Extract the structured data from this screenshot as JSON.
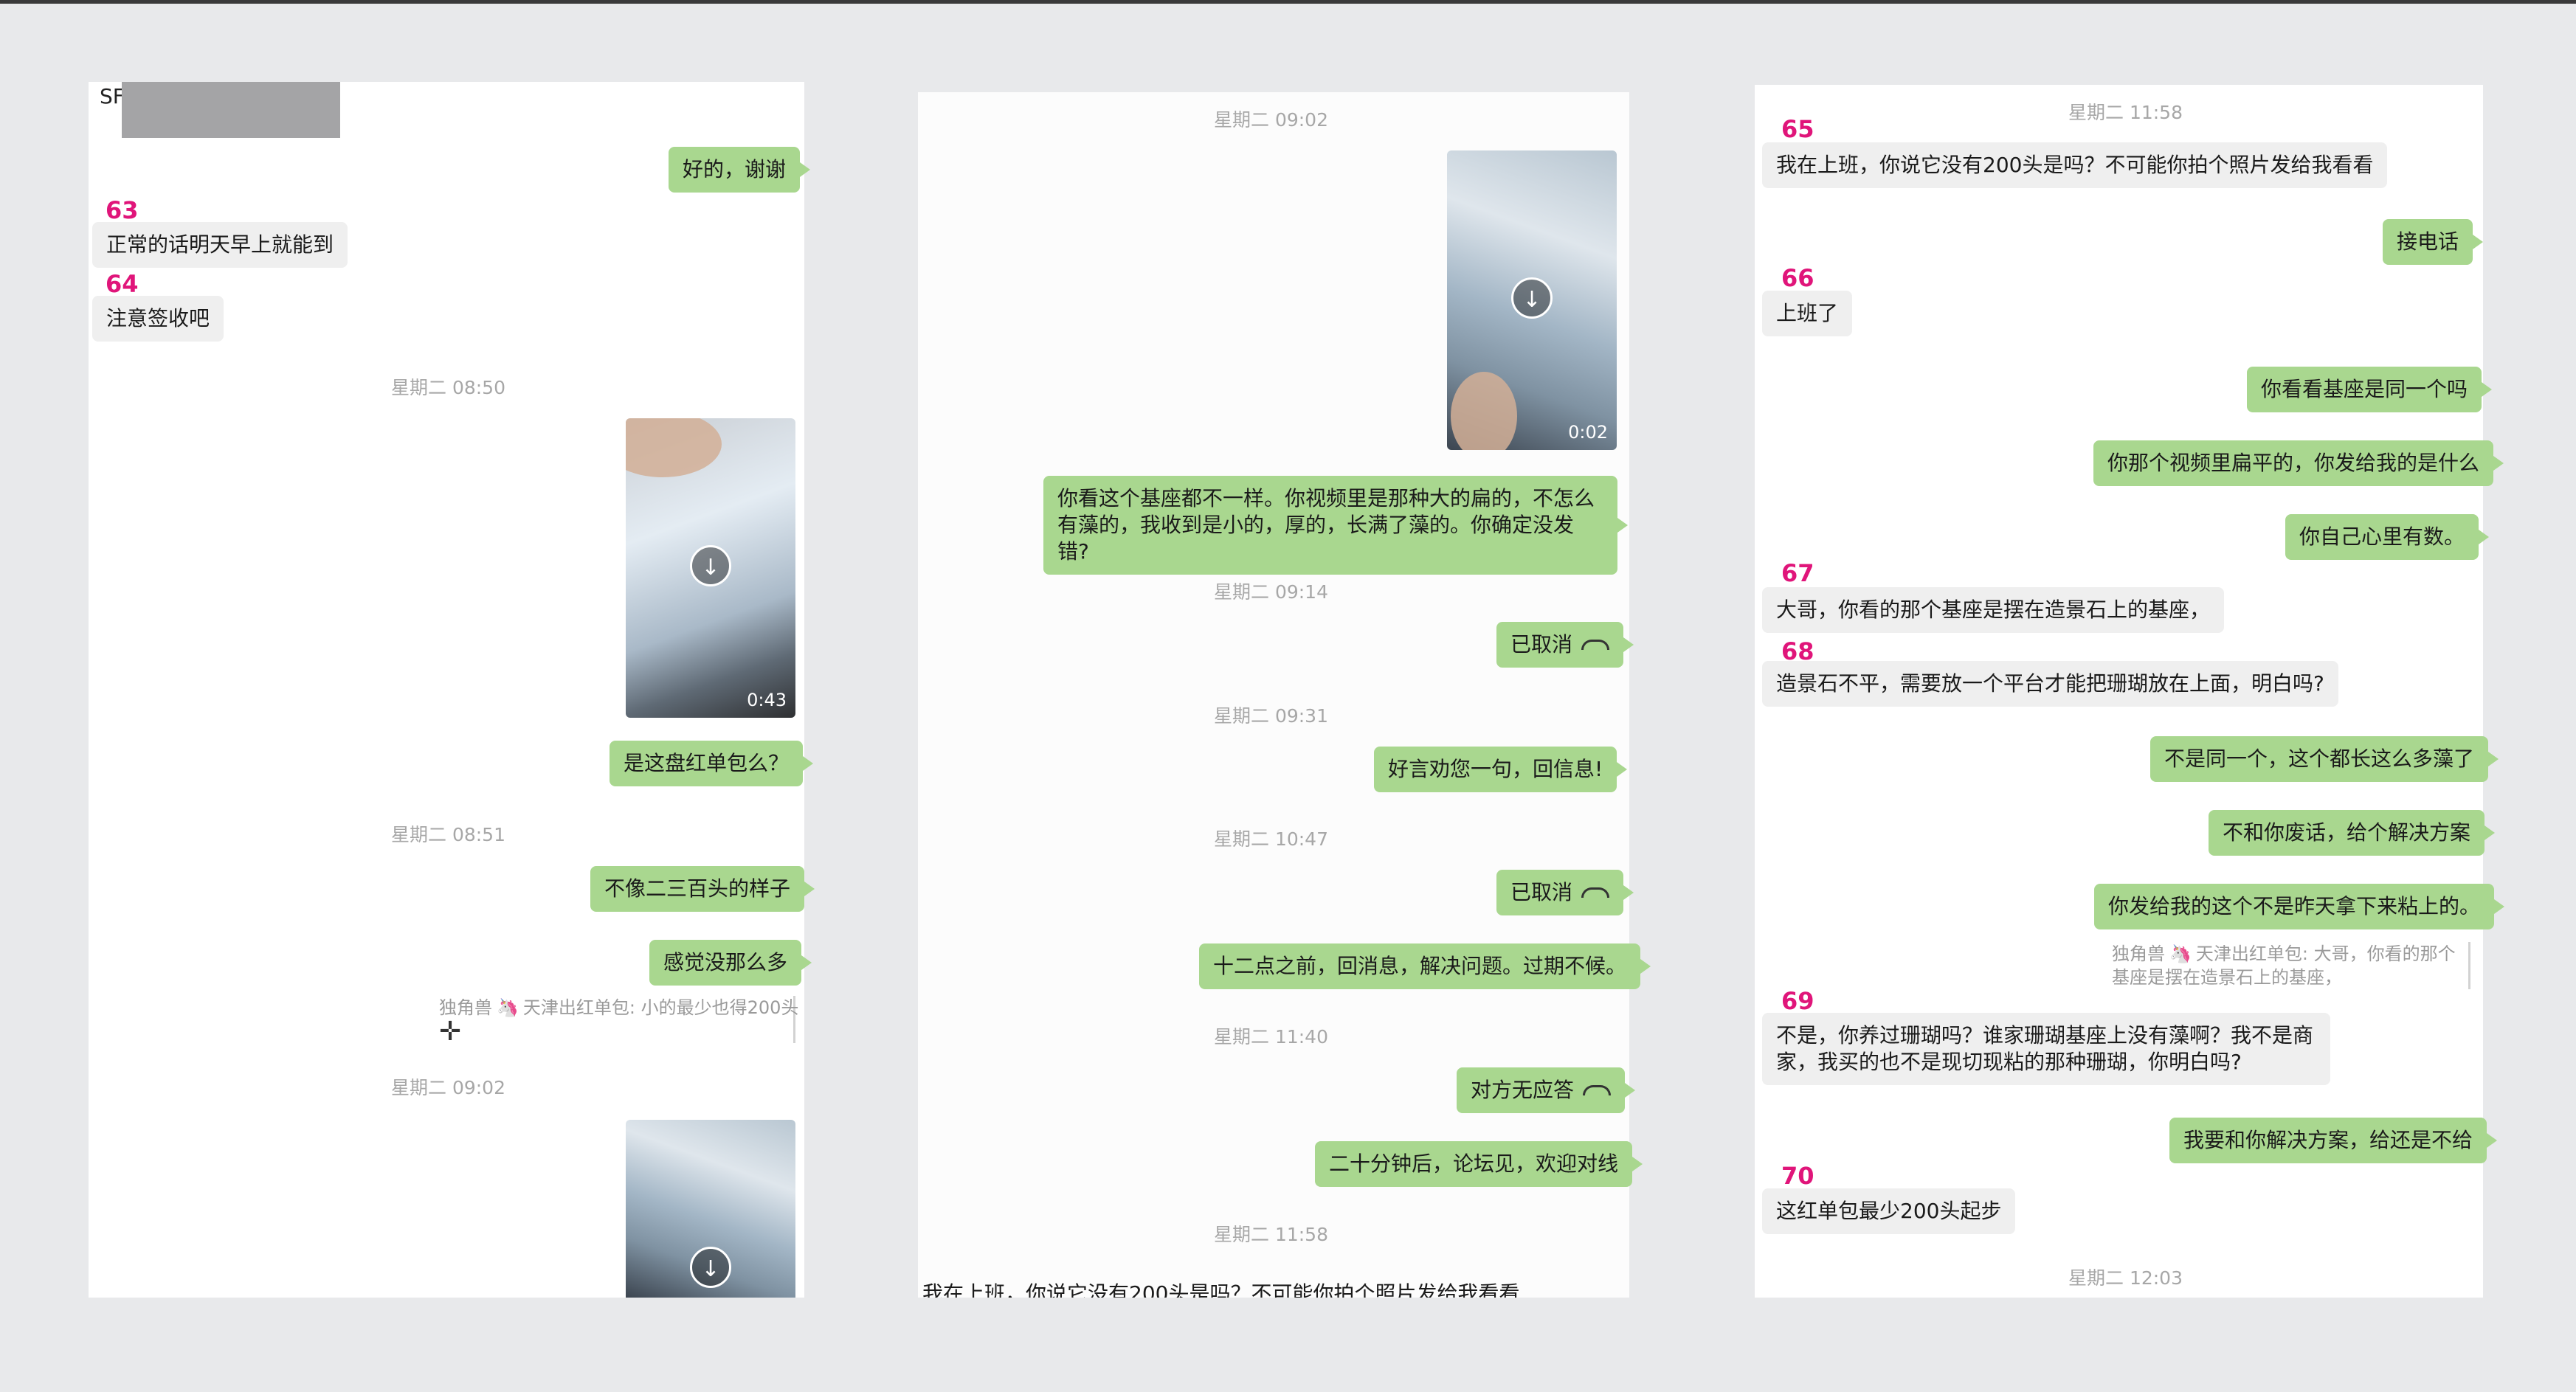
{
  "panel1": {
    "sf_label": "SF",
    "reply_ok_thanks": "好的，谢谢",
    "num_63": "63",
    "msg_63": "正常的话明天早上就能到",
    "num_64": "64",
    "msg_64": "注意签收吧",
    "ts_0850": "星期二 08:50",
    "video1_duration": "0:43",
    "msg_is_this_batch": "是这盘红单包么？",
    "ts_0851": "星期二 08:51",
    "msg_not_like": "不像二三百头的样子",
    "msg_not_many": "感觉没那么多",
    "quote_name": "独角兽",
    "quote_icon": "🦄",
    "quote_text": "天津出红单包: 小的最少也得200头",
    "ts_0902": "星期二 09:02"
  },
  "panel2": {
    "ts_0902": "星期二 09:02",
    "video_duration": "0:02",
    "msg_base_diff": "你看这个基座都不一样。你视频里是那种大的扁的，不怎么有藻的，我收到是小的，厚的，长满了藻的。你确定没发错?",
    "ts_0914": "星期二 09:14",
    "call_cancelled_1": "已取消",
    "ts_0931": "星期二 09:31",
    "msg_advice": "好言劝您一句，回信息!",
    "ts_1047": "星期二 10:47",
    "call_cancelled_2": "已取消",
    "msg_before_noon": "十二点之前，回消息，解决问题。过期不候。",
    "ts_1140": "星期二 11:40",
    "call_no_answer": "对方无应答",
    "msg_forum": "二十分钟后，论坛见，欢迎对线",
    "ts_1158": "星期二 11:58",
    "msg_clipped": "我在上班，你说它没有200头是吗？不可能你拍个照片发给我看看"
  },
  "panel3": {
    "ts_1158": "星期二 11:58",
    "num_65": "65",
    "msg_65": "我在上班，你说它没有200头是吗？不可能你拍个照片发给我看看",
    "msg_answer_phone": "接电话",
    "num_66": "66",
    "msg_66": "上班了",
    "msg_same_base": "你看看基座是同一个吗",
    "msg_video_flat": "你那个视频里扁平的，你发给我的是什么",
    "msg_you_know": "你自己心里有数。",
    "num_67": "67",
    "msg_67": "大哥，你看的那个基座是摆在造景石上的基座，",
    "num_68": "68",
    "msg_68": "造景石不平，需要放一个平台才能把珊瑚放在上面，明白吗?",
    "msg_not_same": "不是同一个，这个都长这么多藻了",
    "msg_no_nonsense": "不和你废话，给个解决方案",
    "msg_not_yesterday": "你发给我的这个不是昨天拿下来粘上的。",
    "quote_name": "独角兽",
    "quote_icon": "🦄",
    "quote_text": "天津出红单包: 大哥，你看的那个基座是摆在造景石上的基座，",
    "num_69": "69",
    "msg_69": "不是，你养过珊瑚吗？谁家珊瑚基座上没有藻啊？我不是商家，我买的也不是现切现粘的那种珊瑚，你明白吗?",
    "msg_solution": "我要和你解决方案，给还是不给",
    "num_70": "70",
    "msg_70": "这红单包最少200头起步",
    "ts_1203": "星期二 12:03"
  }
}
